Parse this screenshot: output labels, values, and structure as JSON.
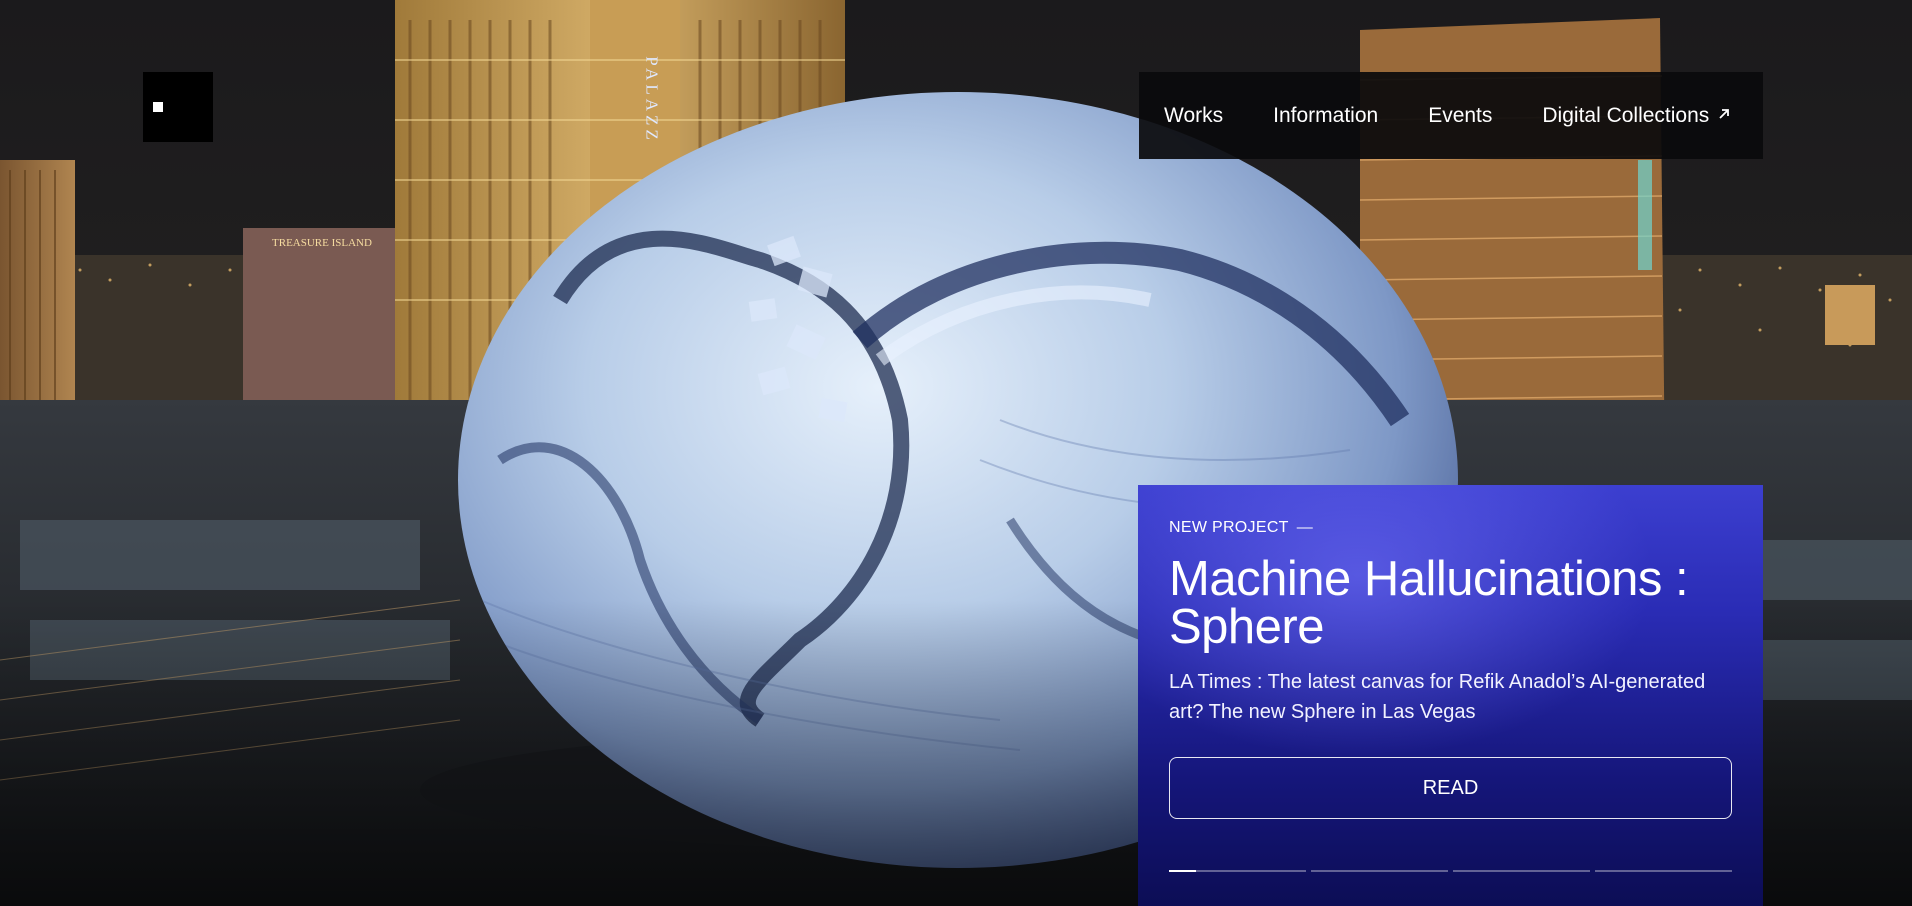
{
  "logo": {
    "label": "Home",
    "icon": "square-logo-icon"
  },
  "nav": {
    "items": [
      {
        "label": "Works"
      },
      {
        "label": "Information"
      },
      {
        "label": "Events"
      },
      {
        "label": "Digital Collections",
        "icon": "external-arrow-icon"
      }
    ]
  },
  "hero": {
    "sign_text": "PALAZZ",
    "sign_text_2": "TREASURE ISLAND",
    "eyebrow": "NEW PROJECT",
    "eyebrow_dash": "—",
    "title": "Machine Hallucinations : Sphere",
    "description": "LA Times : The latest canvas for Refik Anadol’s AI-generated art? The new Sphere in Las Vegas",
    "cta_label": "READ",
    "slides": [
      {
        "progress": 0.2
      },
      {
        "progress": 0
      },
      {
        "progress": 0
      },
      {
        "progress": 0
      }
    ]
  },
  "colors": {
    "card_top": "#3c3fd0",
    "card_bottom": "#0c0d55",
    "nav_bg": "#0a0a0c"
  }
}
